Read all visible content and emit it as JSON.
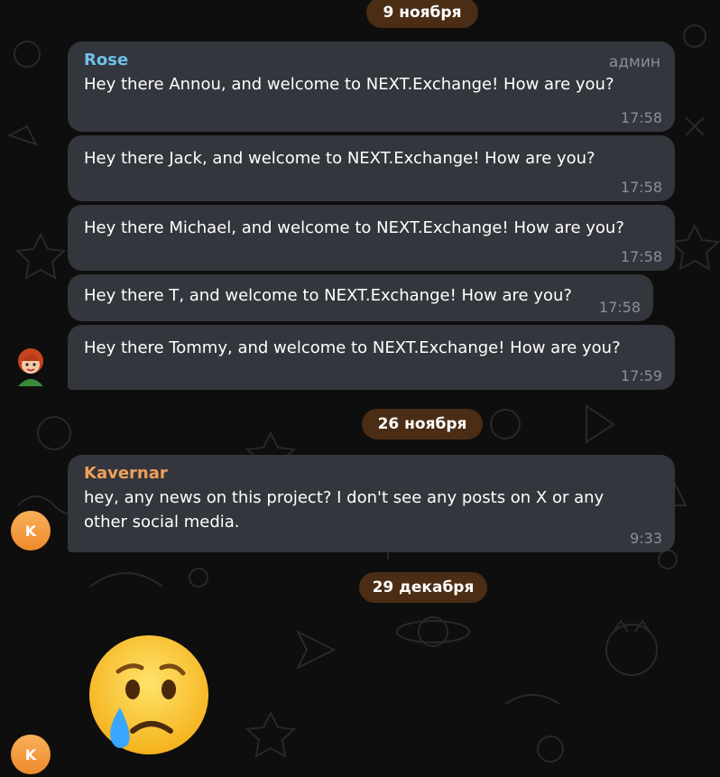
{
  "dates": [
    "9 ноября",
    "26 ноября",
    "29 декабря"
  ],
  "group1": {
    "sender": "Rose",
    "role": "админ",
    "messages": [
      {
        "text": "Hey there Annou, and welcome to NEXT.Exchange! How are you?",
        "time": "17:58"
      },
      {
        "text": "Hey there Jack, and welcome to NEXT.Exchange! How are you?",
        "time": "17:58"
      },
      {
        "text": "Hey there Michael, and welcome to NEXT.Exchange! How are you?",
        "time": "17:58"
      },
      {
        "text": "Hey there T, and welcome to NEXT.Exchange! How are you?",
        "time": "17:58"
      },
      {
        "text": "Hey there Tommy, and welcome to NEXT.Exchange! How are you?",
        "time": "17:59"
      }
    ]
  },
  "group2": {
    "sender": "Kavernar",
    "avatar_letter": "K",
    "text": "hey, any news on this project? I don't see any posts on X or any other social media.",
    "time": "9:33"
  },
  "group3": {
    "avatar_letter": "K",
    "emoji": "crying-face"
  },
  "colors": {
    "rose_name": "#6ec0ea",
    "kavernar_name": "#f0a05a",
    "bubble": "#33363c",
    "date_pill": "#4a2d14",
    "avatar_k": "#f39a3c"
  }
}
